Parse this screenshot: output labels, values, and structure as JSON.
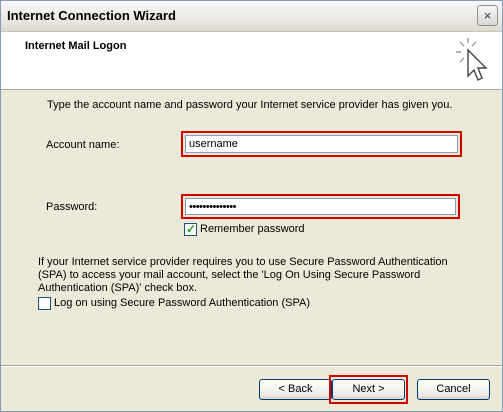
{
  "window": {
    "title": "Internet Connection Wizard",
    "close_symbol": "×"
  },
  "header": {
    "title": "Internet Mail Logon",
    "icon": "wizard-cursor-icon"
  },
  "content": {
    "intro": "Type the account name and password your Internet service provider has given you.",
    "account_label": "Account name:",
    "account_value": "username",
    "password_label": "Password:",
    "password_value": "••••••••••••••",
    "remember_label": "Remember password",
    "remember_checked": true,
    "spa_text": "If your Internet service provider requires you to use Secure Password Authentication (SPA) to access your mail account, select the 'Log On Using Secure Password Authentication (SPA)' check box.",
    "spa_checkbox_label": "Log on using Secure Password Authentication (SPA)",
    "spa_checked": false
  },
  "buttons": {
    "back": "< Back",
    "next": "Next >",
    "cancel": "Cancel"
  },
  "colors": {
    "highlight": "#d40000",
    "window_bg": "#ece9d8",
    "check": "#21a121"
  }
}
